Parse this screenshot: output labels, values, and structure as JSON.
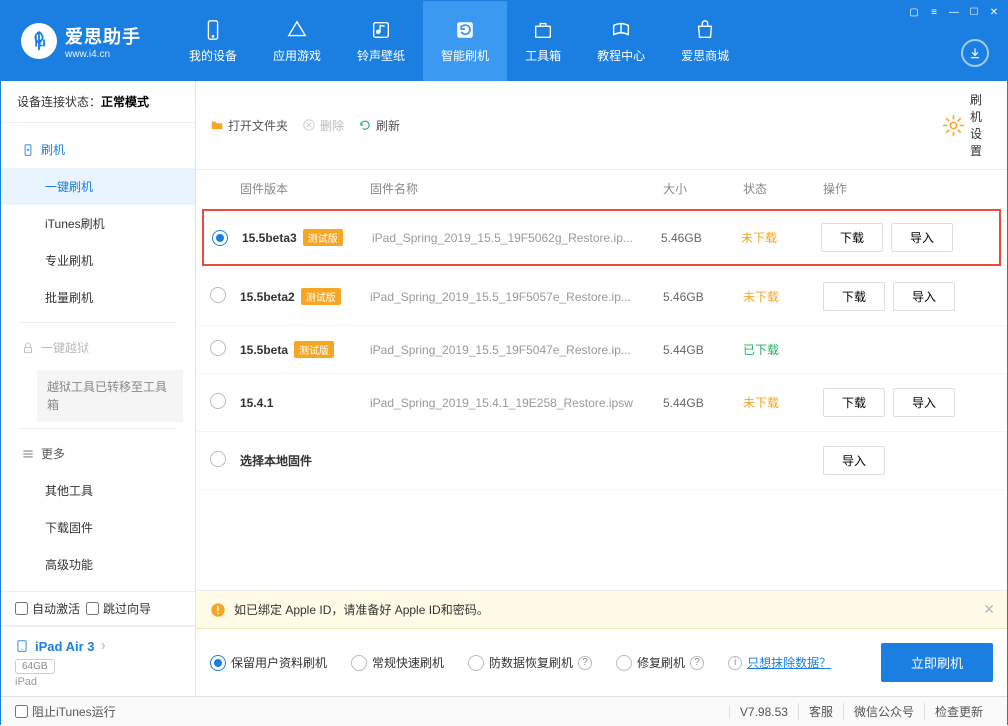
{
  "app": {
    "title": "爱思助手",
    "subtitle": "www.i4.cn"
  },
  "nav": [
    {
      "id": "device",
      "label": "我的设备"
    },
    {
      "id": "apps",
      "label": "应用游戏"
    },
    {
      "id": "media",
      "label": "铃声壁纸"
    },
    {
      "id": "flash",
      "label": "智能刷机",
      "active": true
    },
    {
      "id": "toolbox",
      "label": "工具箱"
    },
    {
      "id": "tutorial",
      "label": "教程中心"
    },
    {
      "id": "store",
      "label": "爱思商城"
    }
  ],
  "connection": {
    "label": "设备连接状态：",
    "status": "正常模式"
  },
  "sidebar": {
    "flash_header": "刷机",
    "items": [
      "一键刷机",
      "iTunes刷机",
      "专业刷机",
      "批量刷机"
    ],
    "jailbreak_header": "一键越狱",
    "jailbreak_note": "越狱工具已转移至工具箱",
    "more_header": "更多",
    "more_items": [
      "其他工具",
      "下载固件",
      "高级功能"
    ]
  },
  "auto_options": {
    "auto_activate": "自动激活",
    "skip_guide": "跳过向导"
  },
  "device": {
    "name": "iPad Air 3",
    "storage": "64GB",
    "type": "iPad"
  },
  "toolbar": {
    "open_folder": "打开文件夹",
    "delete": "删除",
    "refresh": "刷新",
    "settings": "刷机设置"
  },
  "columns": {
    "version": "固件版本",
    "name": "固件名称",
    "size": "大小",
    "status": "状态",
    "actions": "操作"
  },
  "beta_badge": "测试版",
  "firmware": [
    {
      "selected": true,
      "highlighted": true,
      "version": "15.5beta3",
      "beta": true,
      "name": "iPad_Spring_2019_15.5_19F5062g_Restore.ip...",
      "size": "5.46GB",
      "status": "未下载",
      "status_class": "orange",
      "download": true,
      "import": true
    },
    {
      "selected": false,
      "version": "15.5beta2",
      "beta": true,
      "name": "iPad_Spring_2019_15.5_19F5057e_Restore.ip...",
      "size": "5.46GB",
      "status": "未下载",
      "status_class": "orange",
      "download": true,
      "import": true
    },
    {
      "selected": false,
      "version": "15.5beta",
      "beta": true,
      "name": "iPad_Spring_2019_15.5_19F5047e_Restore.ip...",
      "size": "5.44GB",
      "status": "已下载",
      "status_class": "green",
      "download": false,
      "import": false
    },
    {
      "selected": false,
      "version": "15.4.1",
      "beta": false,
      "name": "iPad_Spring_2019_15.4.1_19E258_Restore.ipsw",
      "size": "5.44GB",
      "status": "未下载",
      "status_class": "orange",
      "download": true,
      "import": true
    }
  ],
  "local_firmware": "选择本地固件",
  "buttons": {
    "download": "下载",
    "import": "导入"
  },
  "warning": "如已绑定 Apple ID，请准备好 Apple ID和密码。",
  "modes": {
    "keep_data": "保留用户资料刷机",
    "fast": "常规快速刷机",
    "anti_recovery": "防数据恢复刷机",
    "repair": "修复刷机",
    "erase_link": "只想抹除数据？"
  },
  "flash_button": "立即刷机",
  "statusbar": {
    "block_itunes": "阻止iTunes运行",
    "version": "V7.98.53",
    "support": "客服",
    "wechat": "微信公众号",
    "update": "检查更新"
  }
}
